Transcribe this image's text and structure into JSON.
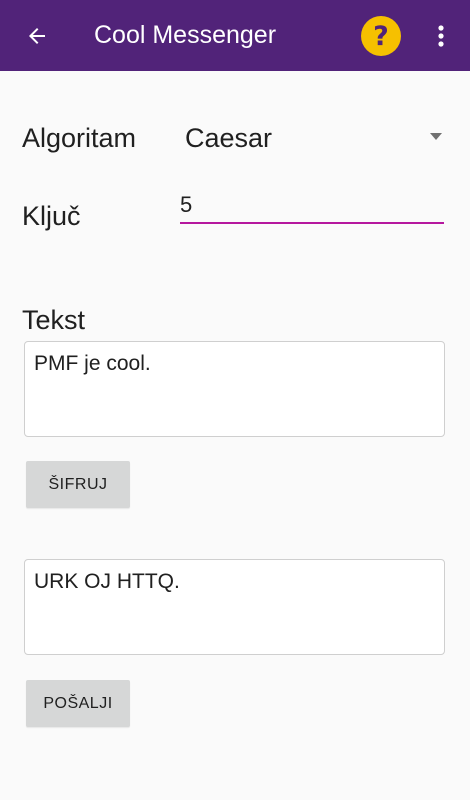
{
  "appbar": {
    "title": "Cool Messenger",
    "back_icon": "arrow-back-icon",
    "help_icon": "help-icon",
    "help_glyph": "?",
    "overflow_icon": "more-vert-icon",
    "colors": {
      "primary": "#512379",
      "help_background": "#f6c000"
    }
  },
  "form": {
    "algorithm_label": "Algoritam",
    "algorithm_value": "Caesar",
    "key_label": "Ključ",
    "key_value": "5",
    "text_label": "Tekst",
    "input_text": "PMF je cool.",
    "encrypt_button": "ŠIFRUJ",
    "output_text": "URK OJ HTTQ.",
    "send_button": "POŠALJI",
    "accent_color": "#b5179e"
  }
}
